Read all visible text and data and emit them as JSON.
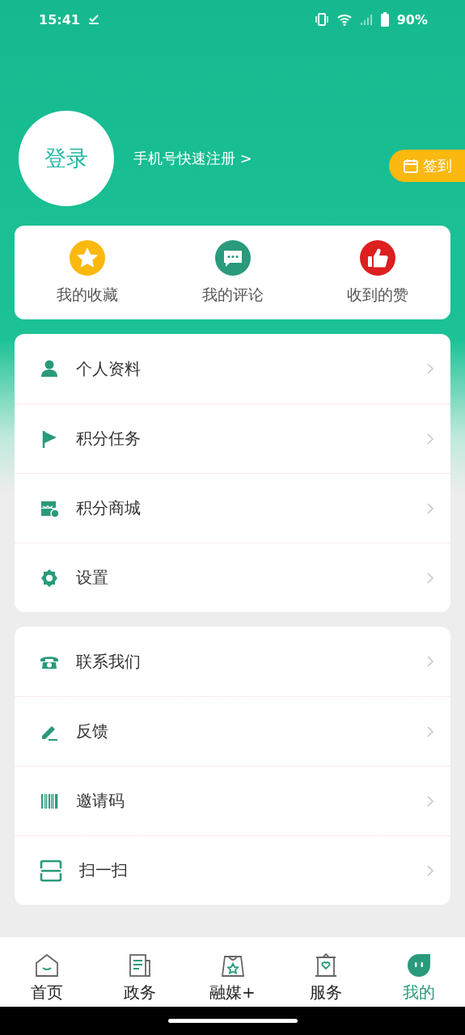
{
  "status_bar": {
    "time": "15:41",
    "battery": "90%"
  },
  "profile": {
    "login": "登录",
    "register_link": "手机号快速注册 >",
    "checkin": "签到"
  },
  "quick_actions": [
    {
      "kind": "star",
      "label": "我的收藏"
    },
    {
      "kind": "comment",
      "label": "我的评论"
    },
    {
      "kind": "like",
      "label": "收到的赞"
    }
  ],
  "menu_groups": [
    [
      {
        "kind": "person",
        "label": "个人资料"
      },
      {
        "kind": "flag",
        "label": "积分任务"
      },
      {
        "kind": "shop",
        "label": "积分商城"
      },
      {
        "kind": "gear",
        "label": "设置"
      }
    ],
    [
      {
        "kind": "phone",
        "label": "联系我们"
      },
      {
        "kind": "pen",
        "label": "反馈"
      },
      {
        "kind": "barcode",
        "label": "邀请码"
      },
      {
        "kind": "scan",
        "label": "扫一扫"
      }
    ]
  ],
  "tabs": [
    {
      "kind": "home",
      "label": "首页",
      "selected": false
    },
    {
      "kind": "news",
      "label": "政务",
      "selected": false
    },
    {
      "kind": "bag",
      "label": "融媒+",
      "selected": false
    },
    {
      "kind": "service",
      "label": "服务",
      "selected": false
    },
    {
      "kind": "me",
      "label": "我的",
      "selected": true
    }
  ]
}
